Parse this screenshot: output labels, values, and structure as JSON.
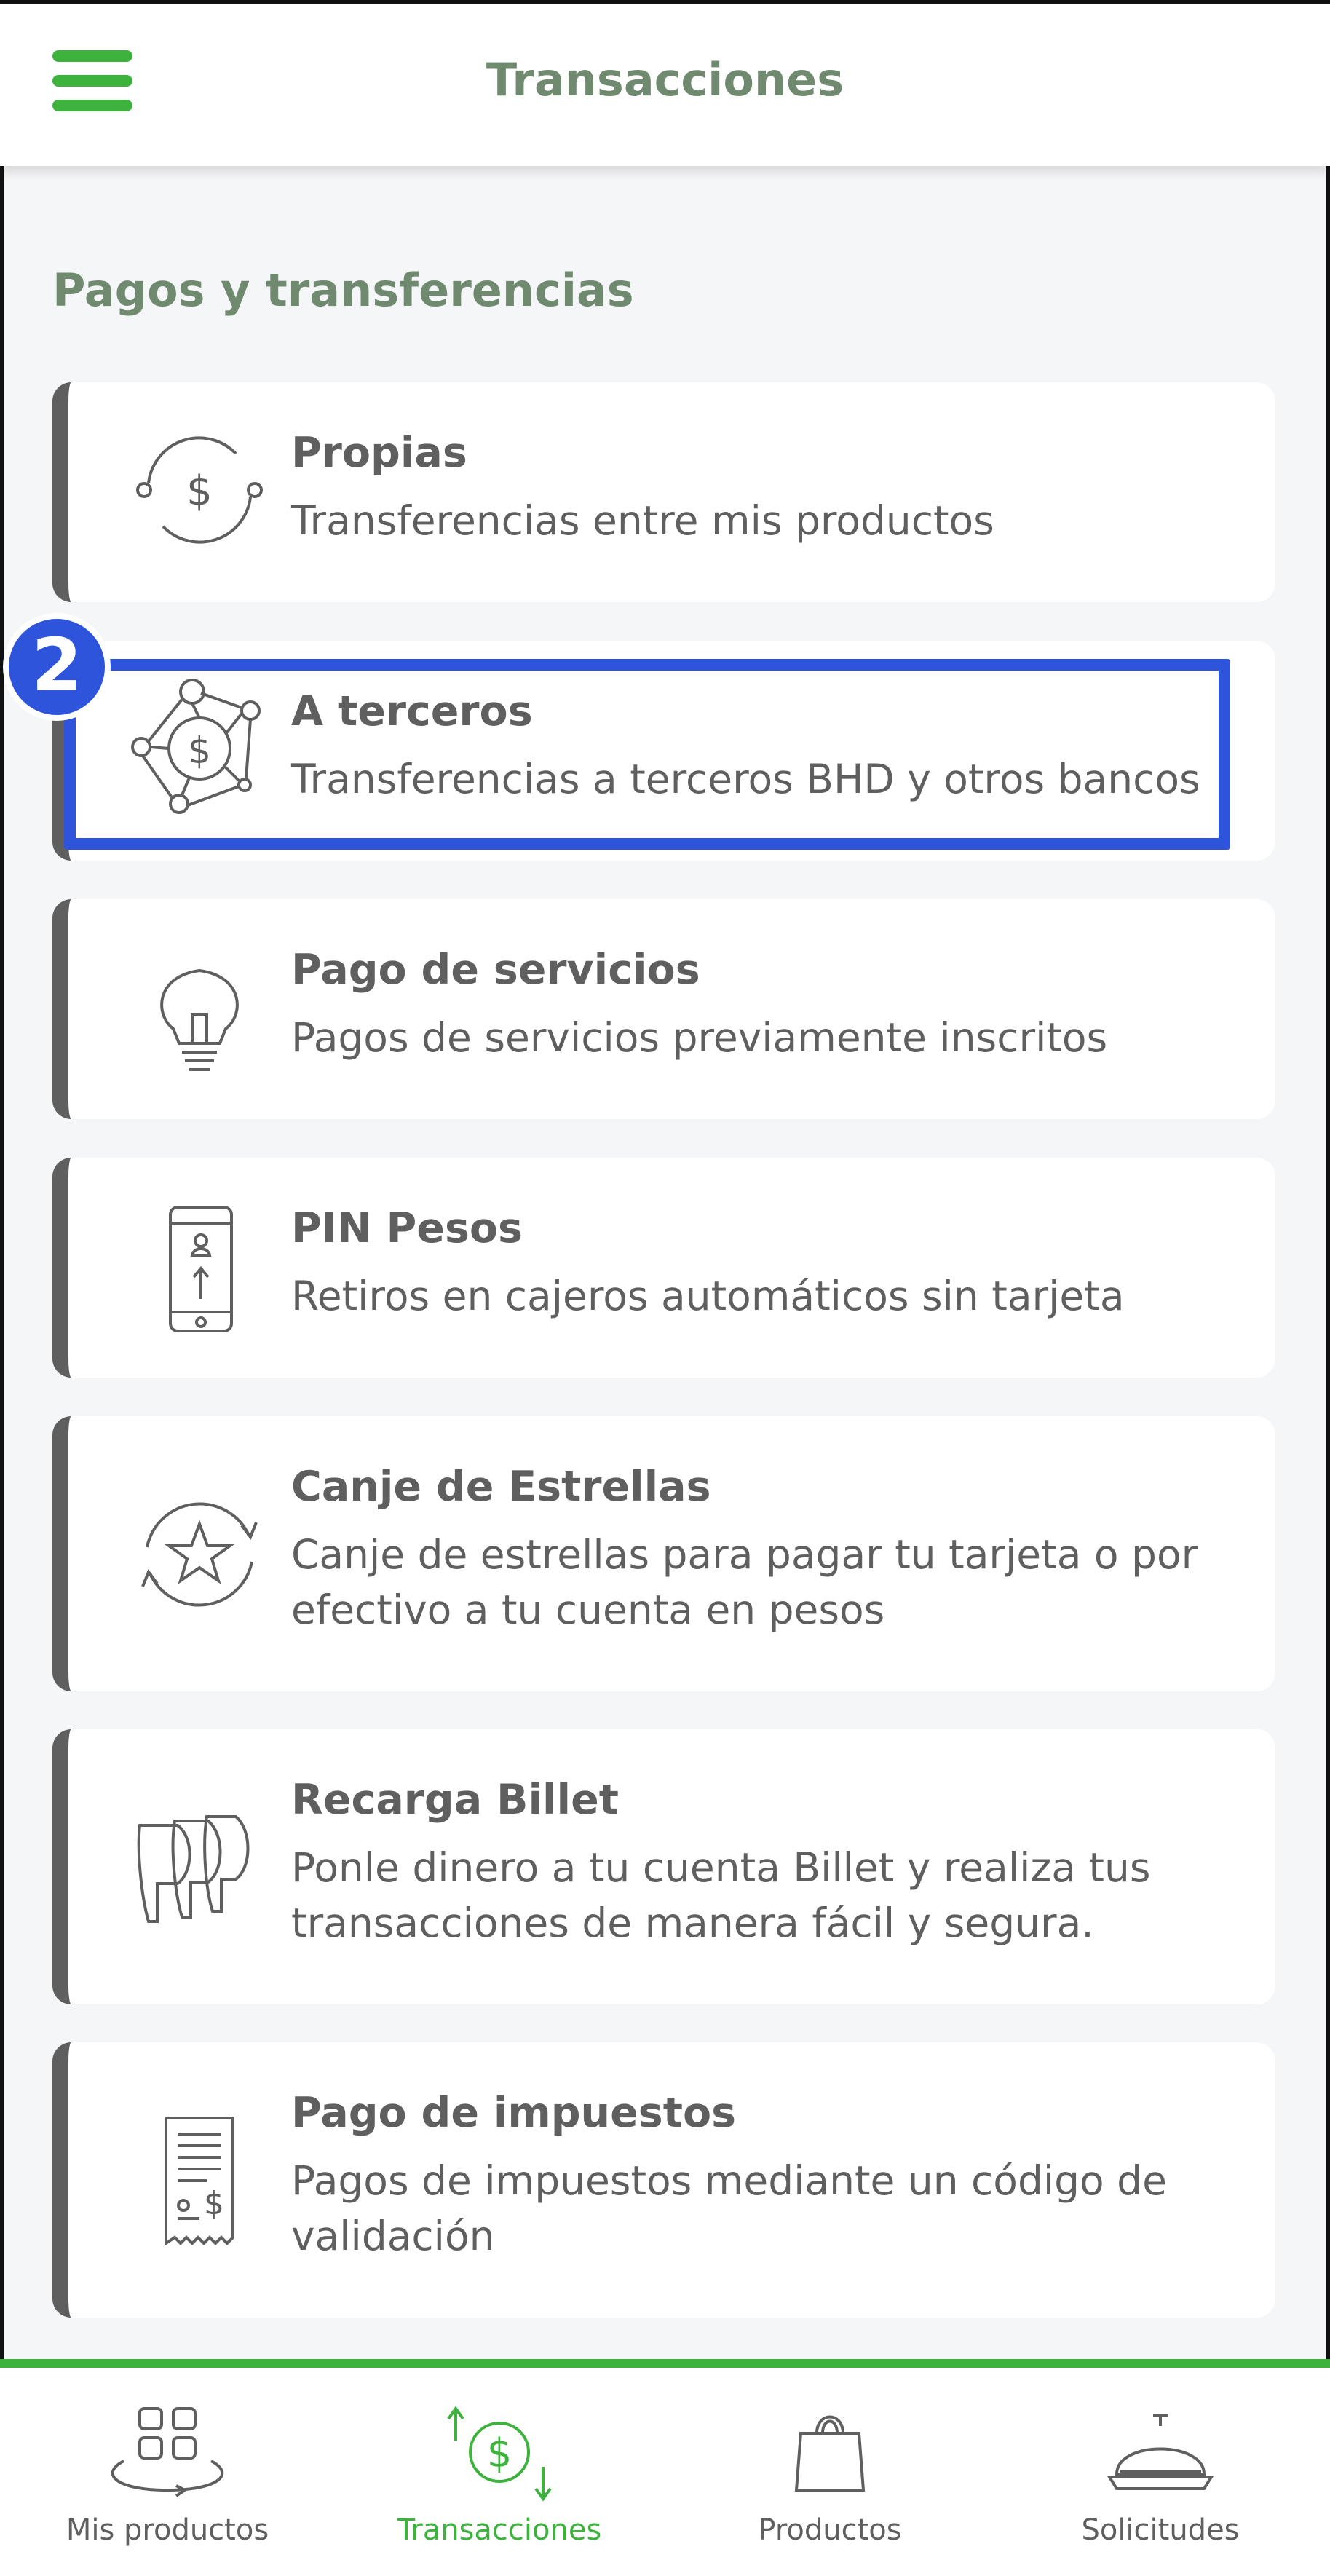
{
  "header": {
    "title": "Transacciones"
  },
  "section": {
    "title": "Pagos y transferencias"
  },
  "cards": [
    {
      "title": "Propias",
      "desc": "Transferencias entre mis productos",
      "icon": "money-transfer-icon"
    },
    {
      "title": "A terceros",
      "desc": "Transferencias a terceros BHD y otros bancos",
      "icon": "network-money-icon"
    },
    {
      "title": "Pago de servicios",
      "desc": "Pagos de servicios previamente inscritos",
      "icon": "lightbulb-icon"
    },
    {
      "title": "PIN Pesos",
      "desc": "Retiros en cajeros automáticos sin tarjeta",
      "icon": "phone-withdraw-icon"
    },
    {
      "title": "Canje de Estrellas",
      "desc": "Canje de estrellas para pagar tu tarjeta o por efectivo a tu cuenta en pesos",
      "icon": "star-exchange-icon"
    },
    {
      "title": "Recarga Billet",
      "desc": "Ponle dinero a tu cuenta Billet y realiza tus transacciones de manera fácil y segura.",
      "icon": "billet-icon"
    },
    {
      "title": "Pago de impuestos",
      "desc": "Pagos de impuestos mediante un código de validación",
      "icon": "receipt-icon"
    }
  ],
  "annotation": {
    "badge": "2"
  },
  "nav": [
    {
      "label": "Mis productos",
      "icon": "grid-products-icon",
      "active": false
    },
    {
      "label": "Transacciones",
      "icon": "transactions-icon",
      "active": true
    },
    {
      "label": "Productos",
      "icon": "shopping-bag-icon",
      "active": false
    },
    {
      "label": "Solicitudes",
      "icon": "service-bell-icon",
      "active": false
    }
  ],
  "colors": {
    "accent": "#3db23d",
    "title": "#6f8a6f",
    "highlight": "#2d54db",
    "text": "#5f5f5f"
  }
}
